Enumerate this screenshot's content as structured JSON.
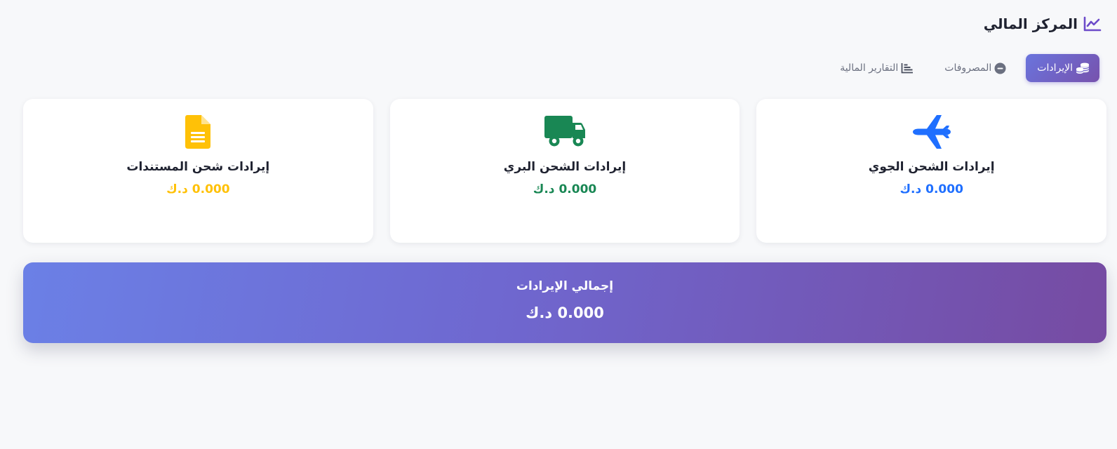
{
  "header": {
    "title": "المركز المالي",
    "icon": "chart-line-icon",
    "icon_color": "#6c4bc9"
  },
  "tabs": [
    {
      "label": "الإيرادات",
      "icon": "coins-icon",
      "active": true
    },
    {
      "label": "المصروفات",
      "icon": "minus-circle-icon",
      "active": false
    },
    {
      "label": "التقارير المالية",
      "icon": "report-chart-icon",
      "active": false
    }
  ],
  "cards": [
    {
      "title": "إيرادات الشحن الجوي",
      "amount": "0.000 د.ك",
      "icon": "plane-icon",
      "color": "#1f6fff"
    },
    {
      "title": "إيرادات الشحن البري",
      "amount": "0.000 د.ك",
      "icon": "truck-icon",
      "color": "#198754"
    },
    {
      "title": "إيرادات شحن المستندات",
      "amount": "0.000 د.ك",
      "icon": "document-icon",
      "color": "#ffc107"
    }
  ],
  "total": {
    "title": "إجمالي الإيرادات",
    "amount": "0.000 د.ك"
  },
  "colors": {
    "accent_gradient_start": "#667eea",
    "accent_gradient_end": "#764ba2",
    "background": "#f7f8fa"
  }
}
